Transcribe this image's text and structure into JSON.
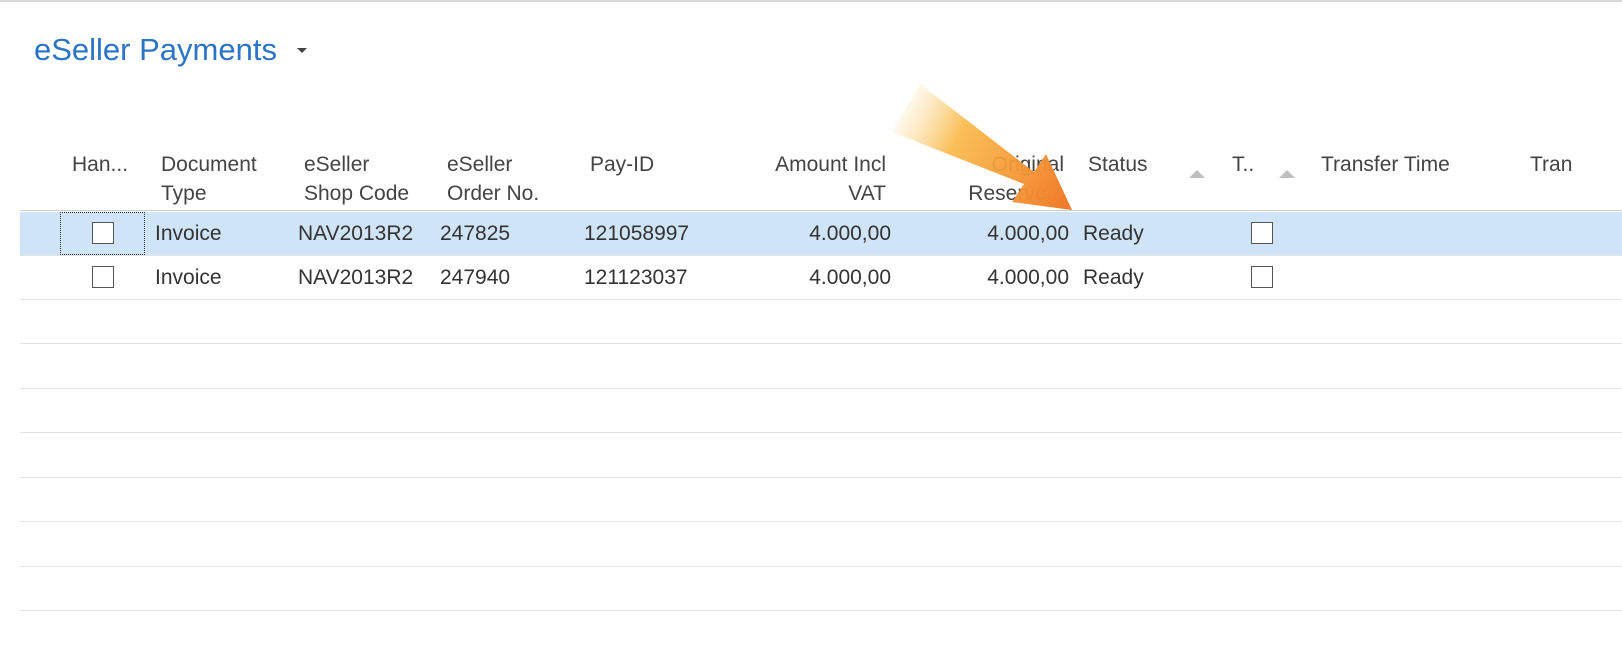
{
  "page": {
    "title": "eSeller Payments"
  },
  "columns": {
    "handled": "Han...",
    "document_type": [
      "Document",
      "Type"
    ],
    "shop_code": [
      "eSeller",
      "Shop Code"
    ],
    "order_no": [
      "eSeller",
      "Order No."
    ],
    "pay_id": "Pay-ID",
    "amount": [
      "Amount Incl",
      "VAT"
    ],
    "original_reserved": [
      "Original",
      "Reserve..."
    ],
    "status": "Status",
    "transferred": "T..",
    "transfer_time": "Transfer Time",
    "next": "Tran"
  },
  "rows": [
    {
      "handled": false,
      "document_type": "Invoice",
      "shop_code": "NAV2013R2",
      "order_no": "247825",
      "pay_id": "121058997",
      "amount": "4.000,00",
      "original_reserved": "4.000,00",
      "status": "Ready",
      "transferred": false,
      "selected": true
    },
    {
      "handled": false,
      "document_type": "Invoice",
      "shop_code": "NAV2013R2",
      "order_no": "247940",
      "pay_id": "121123037",
      "amount": "4.000,00",
      "original_reserved": "4.000,00",
      "status": "Ready",
      "transferred": false,
      "selected": false
    }
  ],
  "colors": {
    "title": "#2b74c6",
    "selected_row": "#cfe4f7",
    "annotation_arrow": "#f5a030"
  }
}
